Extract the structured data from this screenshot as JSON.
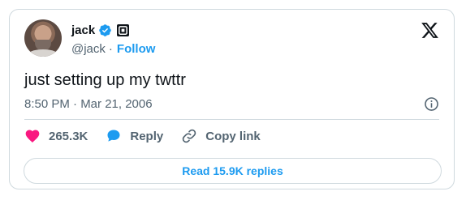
{
  "tweet": {
    "author_name": "jack",
    "handle": "@jack",
    "handle_separator": "·",
    "follow_label": "Follow",
    "text": "just setting up my twttr",
    "timestamp": "8:50 PM · Mar 21, 2006"
  },
  "actions": {
    "likes_count": "265.3K",
    "reply_label": "Reply",
    "copy_link_label": "Copy link"
  },
  "read_replies_label": "Read 15.9K replies",
  "icons": {
    "verified": "verified-badge-icon",
    "square": "square-affiliation-icon",
    "x_logo": "x-logo-icon",
    "info": "info-icon",
    "heart": "heart-icon",
    "reply": "reply-bubble-icon",
    "link": "link-icon"
  },
  "colors": {
    "accent": "#1d9bf0",
    "like": "#f91880",
    "text": "#0f1419",
    "muted": "#536471",
    "border": "#cfd9de"
  }
}
